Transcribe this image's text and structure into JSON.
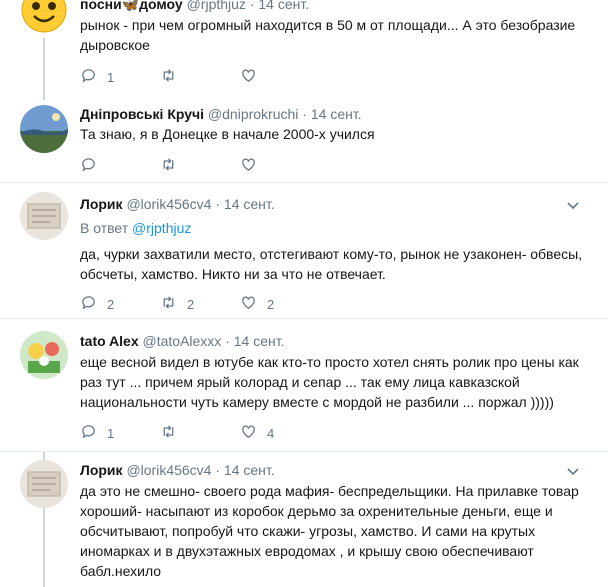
{
  "tweets": [
    {
      "name": "посни🦋домоу",
      "handle": "@rjpthjuz",
      "sep": "·",
      "date": "14 сент.",
      "text": "рынок - при чем огромный находится в 50 м от площади... А это безобразие дыровское",
      "reply_count": "1",
      "retweet_count": "",
      "like_count": ""
    },
    {
      "name": "Дніпровські Кручі",
      "handle": "@dniprokruchi",
      "sep": "·",
      "date": "14 сент.",
      "text": "Та знаю, я в Донецке в начале 2000-х учился",
      "reply_count": "",
      "retweet_count": "",
      "like_count": ""
    },
    {
      "name": "Лорик",
      "handle": "@lorik456cv4",
      "sep": "·",
      "date": "14 сент.",
      "reply_prefix": "В ответ",
      "reply_handle": "@rjpthjuz",
      "text": "да, чурки захватили место, отстегивают кому-то, рынок не узаконен- обвесы, обсчеты, хамство. Никто ни за что не отвечает.",
      "reply_count": "2",
      "retweet_count": "2",
      "like_count": "2"
    },
    {
      "name": "tato Alex",
      "handle": "@tatoAlexxx",
      "sep": "·",
      "date": "14 сент.",
      "text": "еще весной видел в ютубе как кто-то просто хотел снять ролик про цены как раз тут ... причем ярый колорад и сепар ... так ему лица кавказской национальности чуть камеру вместе с мордой не разбили ... поржал )))))",
      "reply_count": "1",
      "retweet_count": "",
      "like_count": "4"
    },
    {
      "name": "Лорик",
      "handle": "@lorik456cv4",
      "sep": "·",
      "date": "14 сент.",
      "text": "да это не смешно- своего рода мафия- беспредельщики. На прилавке товар хороший- насыпают из коробок дерьмо за охренительные деньги, еще и обсчитывают, попробуй что скажи- угрозы, хамство. И сами на крутых иномарках и в двухэтажных евродомах , и крышу свою обеспечивают бабл.нехило"
    }
  ],
  "colors": {
    "accent": "#1b95e0",
    "muted": "#657786",
    "divider": "#e6ecf0",
    "thread_line": "#ccd6dd"
  },
  "icons": [
    "reply-icon",
    "retweet-icon",
    "like-icon",
    "more-chevron-icon"
  ]
}
